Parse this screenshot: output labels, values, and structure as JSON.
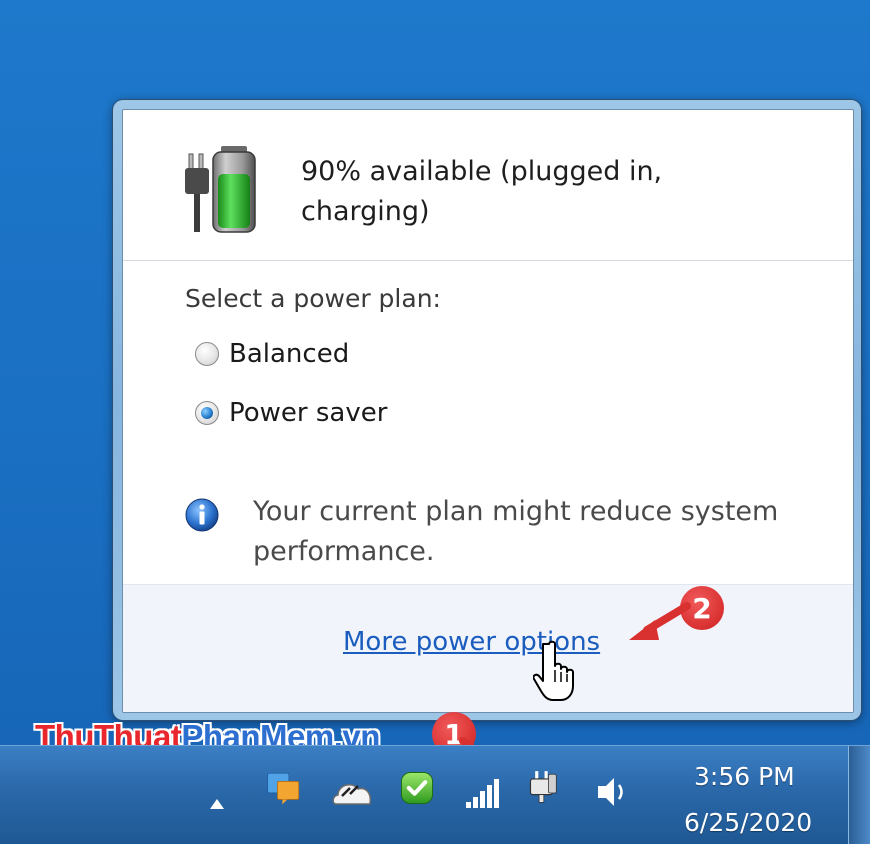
{
  "battery": {
    "status_line1": "90% available (plugged in,",
    "status_line2": "charging)",
    "charge_fraction": 0.9
  },
  "power_plan": {
    "heading": "Select a power plan:",
    "options": [
      {
        "label": "Balanced",
        "selected": false
      },
      {
        "label": "Power saver",
        "selected": true
      }
    ]
  },
  "info": {
    "icon": "info-icon",
    "line1": "Your current plan might reduce system",
    "line2": "performance."
  },
  "footer": {
    "link_label": "More power options"
  },
  "annotations": {
    "badge1": "1",
    "badge2": "2",
    "badge_color": "#d93030"
  },
  "watermark": {
    "part1": "Thu",
    "part2": "Thuat",
    "part3": "PhanMem",
    "part4": ".vn"
  },
  "taskbar": {
    "tray_icons": [
      "show-hidden-icons-arrow",
      "action-center-icon",
      "cloud-icon",
      "security-shield-icon",
      "network-signal-icon",
      "power-plug-icon",
      "volume-icon"
    ],
    "time": "3:56 PM",
    "date": "6/25/2020"
  },
  "colors": {
    "link": "#1a5dbf",
    "desktop": "#1e78cb",
    "taskbar": "#2a68a9"
  }
}
